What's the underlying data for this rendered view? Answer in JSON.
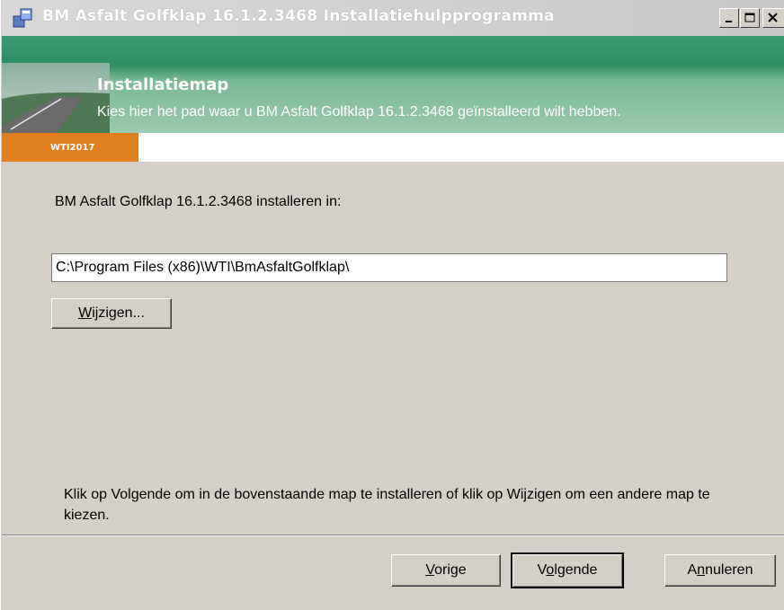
{
  "window": {
    "title": "BM Asfalt Golfklap 16.1.2.3468 Installatiehulpprogramma"
  },
  "banner": {
    "heading": "Installatiemap",
    "subheading": "Kies hier het pad waar u BM Asfalt Golfklap 16.1.2.3468 geïnstalleerd wilt hebben.",
    "tag": "WTI2017"
  },
  "content": {
    "install_label": "BM Asfalt Golfklap 16.1.2.3468 installeren in:",
    "install_path": "C:\\Program Files (x86)\\WTI\\BmAsfaltGolfklap\\",
    "change_button_rest": "ijzigen...",
    "change_button_accel": "W",
    "hint": "Klik op Volgende om in de bovenstaande map te installeren of klik op Wijzigen om een andere map te kiezen."
  },
  "footer": {
    "back_accel": "V",
    "back_rest": "orige",
    "next_pre": "V",
    "next_accel": "o",
    "next_rest": "lgende",
    "cancel_pre": "A",
    "cancel_accel": "n",
    "cancel_rest": "nuleren"
  },
  "colors": {
    "banner_green": "#2e8c62",
    "tag_orange": "#e07d1e",
    "dialog_face": "#d4d0c8"
  }
}
